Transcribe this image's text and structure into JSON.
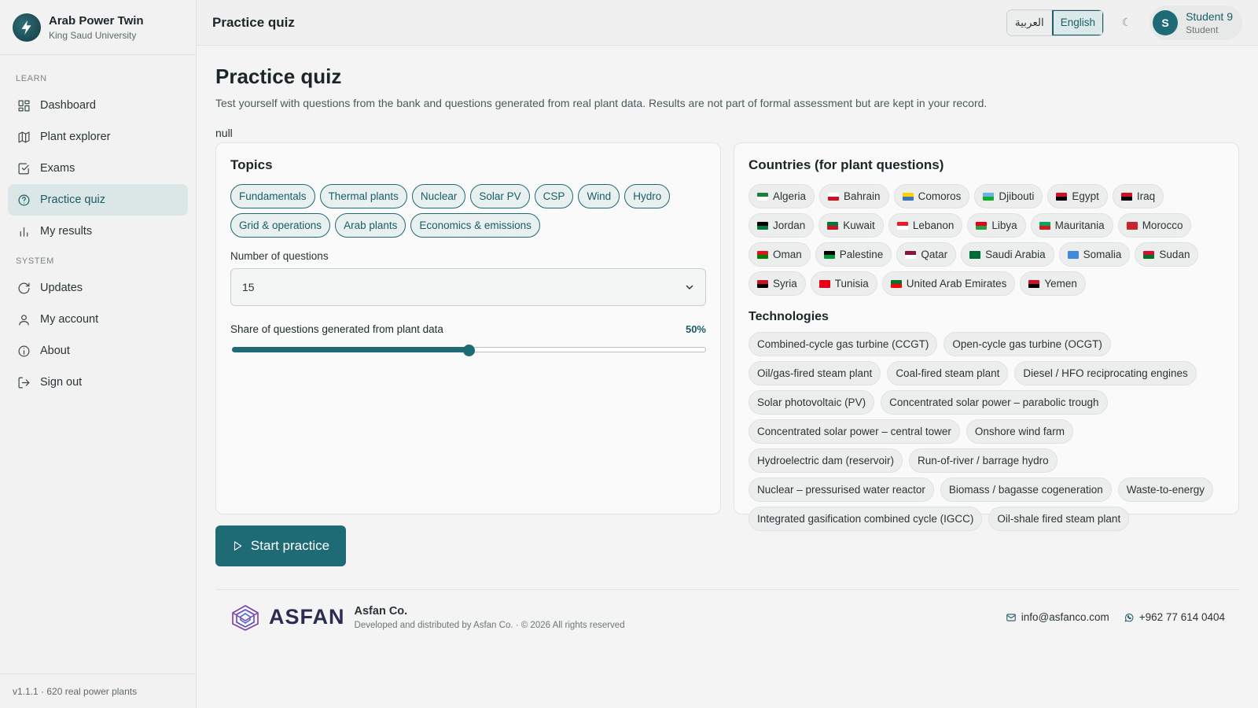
{
  "brand": {
    "title": "Arab Power Twin",
    "subtitle": "King Saud University"
  },
  "sidebar": {
    "sections": [
      {
        "label": "LEARN"
      },
      {
        "label": "SYSTEM"
      }
    ],
    "items": [
      {
        "label": "Dashboard",
        "icon": "grid-icon"
      },
      {
        "label": "Plant explorer",
        "icon": "map-icon"
      },
      {
        "label": "Exams",
        "icon": "checkbox-icon"
      },
      {
        "label": "Practice quiz",
        "icon": "help-circle-icon",
        "active": true
      },
      {
        "label": "My results",
        "icon": "bar-chart-icon"
      },
      {
        "label": "Updates",
        "icon": "refresh-icon"
      },
      {
        "label": "My account",
        "icon": "user-icon"
      },
      {
        "label": "About",
        "icon": "info-icon"
      },
      {
        "label": "Sign out",
        "icon": "logout-icon"
      }
    ],
    "footer": "v1.1.1 · 620 real power plants"
  },
  "topbar": {
    "title": "Practice quiz",
    "lang_ar": "العربية",
    "lang_en": "English",
    "active_lang": "English",
    "theme_icon": "☾",
    "user": {
      "initial": "S",
      "name": "Student 9",
      "role": "Student"
    }
  },
  "main": {
    "title": "Practice quiz",
    "description": "Test yourself with questions from the bank and questions generated from real plant data. Results are not part of formal assessment but are kept in your record.",
    "null_text": "null",
    "topics": {
      "title": "Topics",
      "items": [
        "Fundamentals",
        "Thermal plants",
        "Nuclear",
        "Solar PV",
        "CSP",
        "Wind",
        "Hydro",
        "Grid & operations",
        "Arab plants",
        "Economics & emissions"
      ]
    },
    "num_questions": {
      "label": "Number of questions",
      "value": "15"
    },
    "plant_share": {
      "label": "Share of questions generated from plant data",
      "value_text": "50%",
      "value": 0.5
    },
    "countries": {
      "title": "Countries (for plant questions)",
      "items": [
        {
          "name": "Algeria",
          "flag": [
            "#1b7f3b",
            "#ffffff"
          ]
        },
        {
          "name": "Bahrain",
          "flag": [
            "#ffffff",
            "#ce1126"
          ]
        },
        {
          "name": "Comoros",
          "flag": [
            "#ffd100",
            "#3a75c4"
          ]
        },
        {
          "name": "Djibouti",
          "flag": [
            "#6ab2e7",
            "#12ad2b"
          ]
        },
        {
          "name": "Egypt",
          "flag": [
            "#ce1126",
            "#000000"
          ]
        },
        {
          "name": "Iraq",
          "flag": [
            "#ce1126",
            "#000000"
          ]
        },
        {
          "name": "Jordan",
          "flag": [
            "#000000",
            "#007a3d"
          ]
        },
        {
          "name": "Kuwait",
          "flag": [
            "#007a3d",
            "#ce1126"
          ]
        },
        {
          "name": "Lebanon",
          "flag": [
            "#ed1c24",
            "#ffffff"
          ]
        },
        {
          "name": "Libya",
          "flag": [
            "#e70013",
            "#239e46"
          ]
        },
        {
          "name": "Mauritania",
          "flag": [
            "#00a95c",
            "#d01c1f"
          ]
        },
        {
          "name": "Morocco",
          "flag": [
            "#c1272d",
            "#c1272d"
          ]
        },
        {
          "name": "Oman",
          "flag": [
            "#db161b",
            "#008000"
          ]
        },
        {
          "name": "Palestine",
          "flag": [
            "#000000",
            "#009736"
          ]
        },
        {
          "name": "Qatar",
          "flag": [
            "#8a1538",
            "#ffffff"
          ]
        },
        {
          "name": "Saudi Arabia",
          "flag": [
            "#006c35",
            "#006c35"
          ]
        },
        {
          "name": "Somalia",
          "flag": [
            "#4189dd",
            "#4189dd"
          ]
        },
        {
          "name": "Sudan",
          "flag": [
            "#d21034",
            "#007229"
          ]
        },
        {
          "name": "Syria",
          "flag": [
            "#ce1126",
            "#000000"
          ]
        },
        {
          "name": "Tunisia",
          "flag": [
            "#e70013",
            "#e70013"
          ]
        },
        {
          "name": "United Arab Emirates",
          "flag": [
            "#00732f",
            "#ff0000"
          ]
        },
        {
          "name": "Yemen",
          "flag": [
            "#ce1126",
            "#000000"
          ]
        }
      ]
    },
    "technologies": {
      "title": "Technologies",
      "items": [
        "Combined-cycle gas turbine (CCGT)",
        "Open-cycle gas turbine (OCGT)",
        "Oil/gas-fired steam plant",
        "Coal-fired steam plant",
        "Diesel / HFO reciprocating engines",
        "Solar photovoltaic (PV)",
        "Concentrated solar power – parabolic trough",
        "Concentrated solar power – central tower",
        "Onshore wind farm",
        "Hydroelectric dam (reservoir)",
        "Run-of-river / barrage hydro",
        "Nuclear – pressurised water reactor",
        "Biomass / bagasse cogeneration",
        "Waste-to-energy",
        "Integrated gasification combined cycle (IGCC)",
        "Oil-shale fired steam plant"
      ]
    },
    "start_button": "Start practice"
  },
  "footer": {
    "wordmark": "ASFAN",
    "company": "Asfan Co.",
    "copyright": "Developed and distributed by Asfan Co. · © 2026 All rights reserved",
    "email": "info@asfanco.com",
    "phone": "+962 77 614 0404"
  },
  "colors": {
    "accent": "#1f6b75",
    "accent_light": "#dbe6e6"
  }
}
